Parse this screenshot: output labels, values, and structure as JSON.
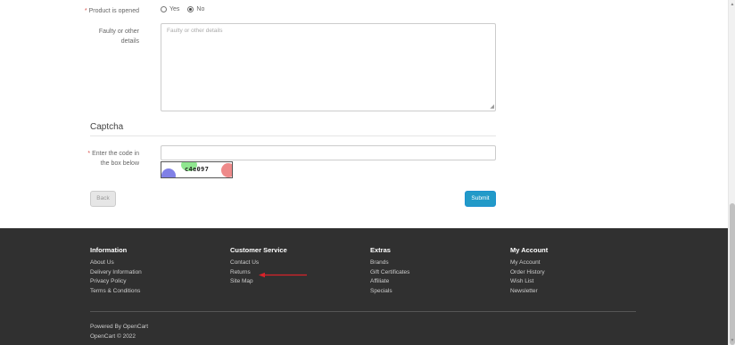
{
  "form": {
    "product_opened": {
      "required": "*",
      "label": "Product is opened",
      "options": [
        {
          "label": "Yes",
          "checked": false
        },
        {
          "label": "No",
          "checked": true
        }
      ]
    },
    "faulty": {
      "label_line1": "Faulty or other",
      "label_line2": "details",
      "placeholder": "Faulty or other details"
    }
  },
  "captcha": {
    "legend": "Captcha",
    "required": "*",
    "label_line1": "Enter the code in",
    "label_line2": "the box below",
    "code": "c4e097"
  },
  "buttons": {
    "back": "Back",
    "submit": "Submit"
  },
  "footer": {
    "columns": [
      {
        "title": "Information",
        "links": [
          "About Us",
          "Delivery Information",
          "Privacy Policy",
          "Terms & Conditions"
        ]
      },
      {
        "title": "Customer Service",
        "links": [
          "Contact Us",
          "Returns",
          "Site Map"
        ]
      },
      {
        "title": "Extras",
        "links": [
          "Brands",
          "Gift Certificates",
          "Affiliate",
          "Specials"
        ]
      },
      {
        "title": "My Account",
        "links": [
          "My Account",
          "Order History",
          "Wish List",
          "Newsletter"
        ]
      }
    ],
    "powered_by": "Powered By OpenCart",
    "copyright": "OpenCart © 2022"
  },
  "colors": {
    "footer_bg": "#303030",
    "submit_bg": "#229ac8",
    "required": "#d9534f",
    "annotation_arrow": "#d9232a"
  }
}
